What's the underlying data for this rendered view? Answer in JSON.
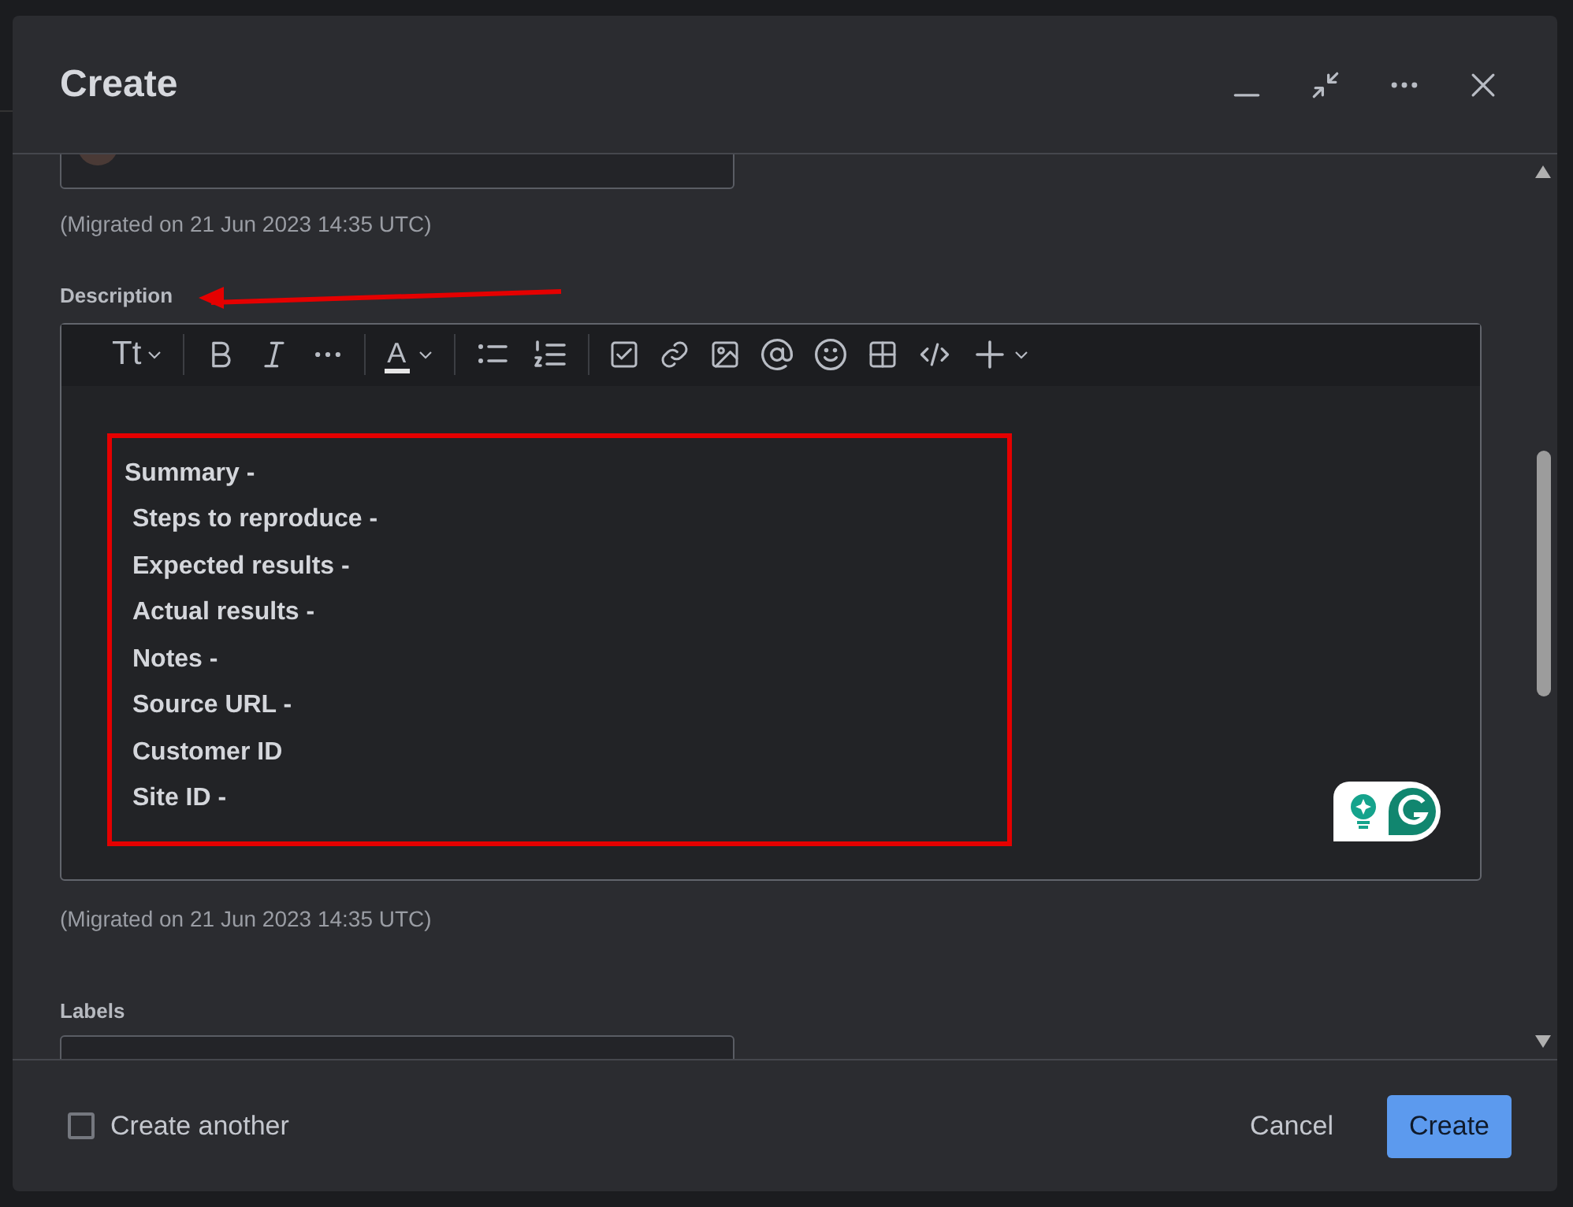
{
  "window": {
    "title": "Create"
  },
  "fields": {
    "assignee_note": "(Migrated on 21 Jun 2023 14:35 UTC)",
    "description": {
      "label": "Description",
      "toolbar": {
        "text_style": "Tt",
        "font_color": "A"
      },
      "lines": [
        "Summary -",
        "Steps to reproduce -",
        "Expected results -",
        "Actual results -",
        "Notes -",
        "Source URL -",
        "Customer ID",
        "Site ID -"
      ],
      "note": "(Migrated on 21 Jun 2023 14:35 UTC)"
    },
    "labels": {
      "label": "Labels"
    }
  },
  "footer": {
    "create_another": {
      "label": "Create another",
      "checked": false
    },
    "buttons": [
      {
        "label": "Cancel",
        "kind": "secondary"
      },
      {
        "label": "Create",
        "kind": "primary"
      }
    ]
  }
}
